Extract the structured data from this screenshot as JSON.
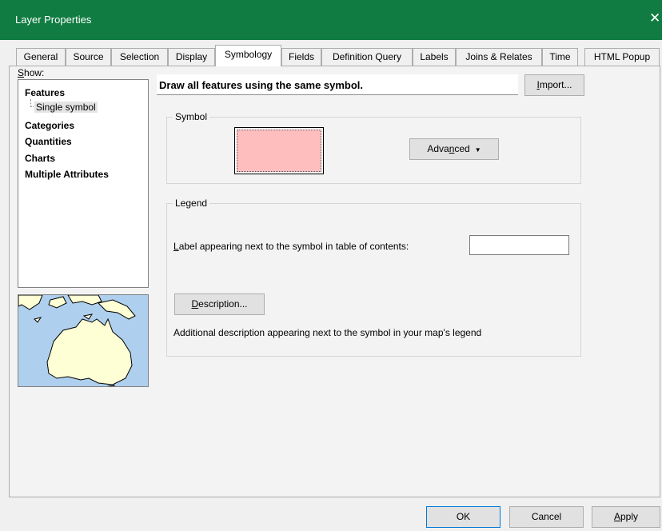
{
  "window": {
    "title": "Layer Properties",
    "close_glyph": "✕"
  },
  "tabs": [
    {
      "label": "General",
      "active": false
    },
    {
      "label": "Source",
      "active": false
    },
    {
      "label": "Selection",
      "active": false
    },
    {
      "label": "Display",
      "active": false
    },
    {
      "label": "Symbology",
      "active": true
    },
    {
      "label": "Fields",
      "active": false
    },
    {
      "label": "Definition Query",
      "active": false
    },
    {
      "label": "Labels",
      "active": false
    },
    {
      "label": "Joins & Relates",
      "active": false
    },
    {
      "label": "Time",
      "active": false
    },
    {
      "label": "HTML Popup",
      "active": false
    }
  ],
  "show": {
    "label_prefix": "S",
    "label_rest": "how:",
    "items": [
      "Features",
      "Categories",
      "Quantities",
      "Charts",
      "Multiple Attributes"
    ],
    "sub_item": "Single symbol"
  },
  "main": {
    "heading": "Draw all features using the same symbol.",
    "import": {
      "prefix": "I",
      "rest": "mport..."
    }
  },
  "symbol": {
    "group_title": "Symbol",
    "swatch_color": "#ffbebe",
    "advanced": {
      "before": "Adva",
      "mnemonic": "n",
      "after": "ced",
      "arrow": "▼"
    }
  },
  "legend": {
    "group_title": "Legend",
    "label_prefix": "L",
    "label_rest": "abel appearing next to the symbol in table of contents:",
    "label_value": "",
    "description_button": {
      "prefix": "D",
      "rest": "escription..."
    },
    "description_text": "Additional description appearing next to the symbol in your map's legend"
  },
  "footer": {
    "ok": "OK",
    "cancel": "Cancel",
    "apply": {
      "prefix": "A",
      "rest": "pply"
    }
  },
  "colors": {
    "titlebar": "#107c41",
    "water": "#aecfed",
    "land": "#ffffd6"
  }
}
